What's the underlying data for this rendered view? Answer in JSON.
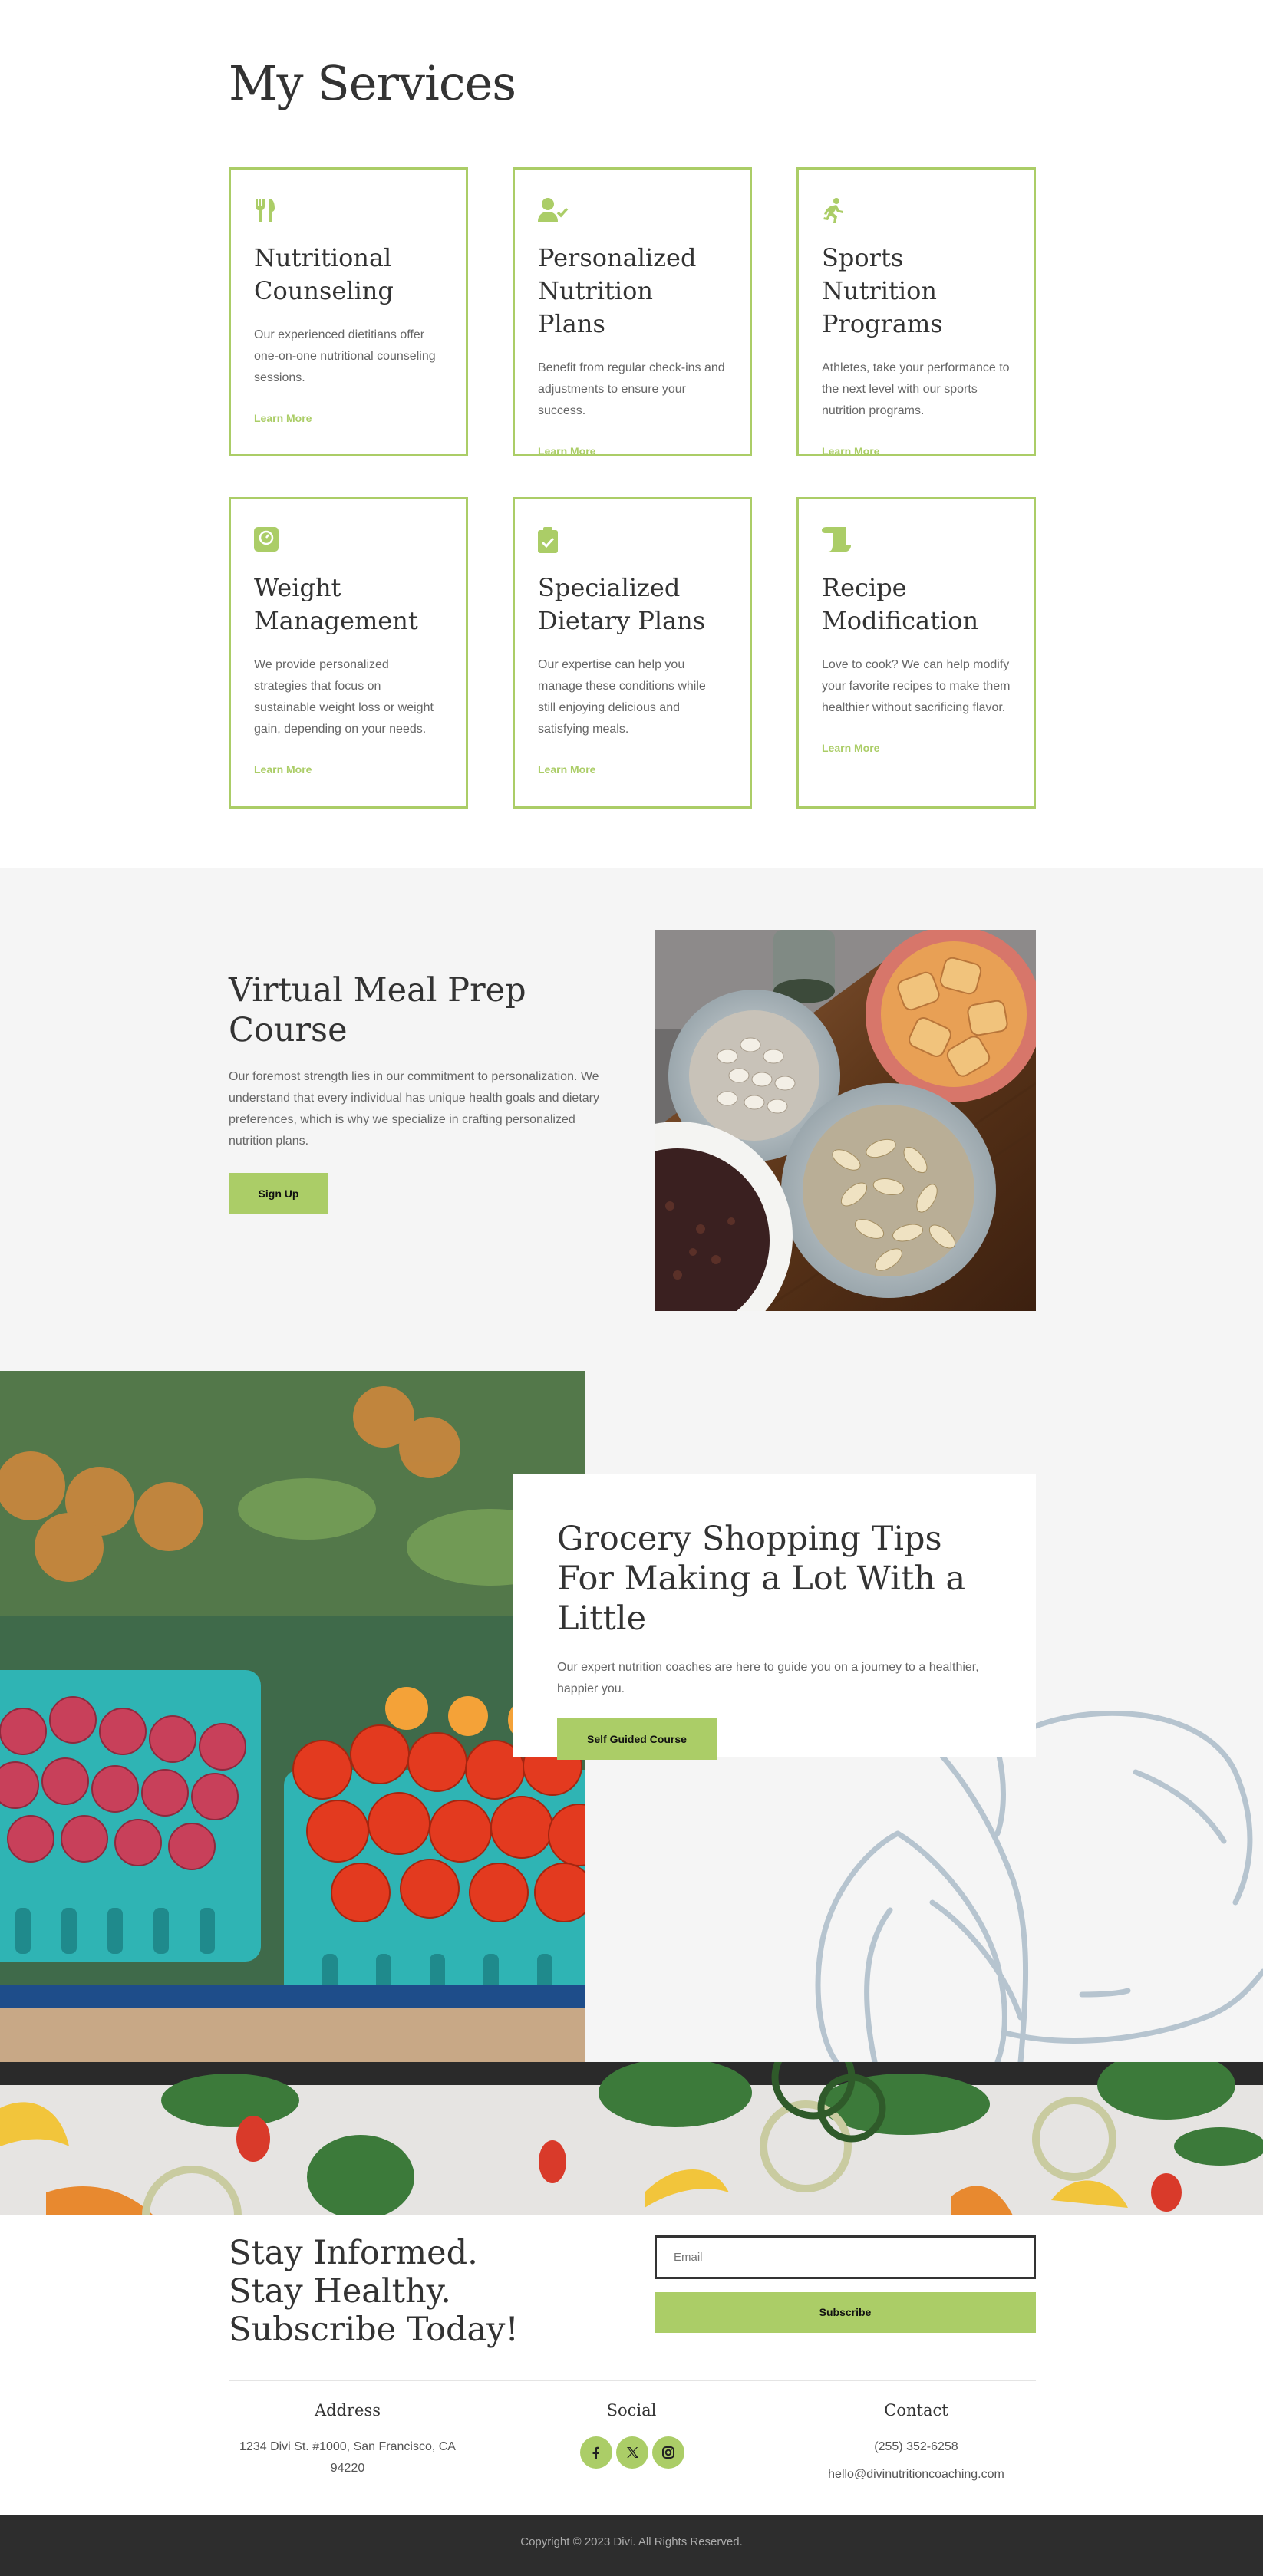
{
  "services": {
    "title": "My Services",
    "cards": [
      {
        "icon": "utensils-icon",
        "title": "Nutritional Counseling",
        "text": "Our experienced dietitians offer one-on-one nutritional counseling sessions.",
        "link": "Learn More"
      },
      {
        "icon": "user-check-icon",
        "title": "Personalized Nutrition Plans",
        "text": "Benefit from regular check-ins and adjustments to ensure your success.",
        "link": "Learn More"
      },
      {
        "icon": "running-person-icon",
        "title": "Sports Nutrition Programs",
        "text": "Athletes, take your performance to the next level with our sports nutrition programs.",
        "link": "Learn More"
      },
      {
        "icon": "weight-scale-icon",
        "title": "Weight Management",
        "text": "We provide personalized strategies that focus on sustainable weight loss or weight gain, depending on your needs.",
        "link": "Learn More"
      },
      {
        "icon": "clipboard-check-icon",
        "title": "Specialized Dietary Plans",
        "text": "Our expertise can help you manage these conditions while still enjoying delicious and satisfying meals.",
        "link": "Learn More"
      },
      {
        "icon": "scroll-icon",
        "title": "Recipe Modification",
        "text": "Love to cook? We can help modify your favorite recipes to make them healthier without sacrificing flavor.",
        "link": "Learn More"
      }
    ]
  },
  "virtual": {
    "title": "Virtual Meal Prep Course",
    "text": "Our foremost strength lies in our commitment to personalization. We understand that every individual has unique health goals and dietary preferences, which is why we specialize in crafting personalized nutrition plans.",
    "button": "Sign Up"
  },
  "grocery": {
    "title": "Grocery Shopping Tips For Making a Lot With a Little",
    "text": "Our expert nutrition coaches are here to guide you on a journey to a healthier, happier you.",
    "button": "Self Guided Course"
  },
  "newsletter": {
    "title": "Stay Informed. Stay Healthy. Subscribe Today!",
    "email_placeholder": "Email",
    "button": "Subscribe"
  },
  "footer": {
    "address_heading": "Address",
    "address_line1": "1234 Divi St. #1000, San Francisco, CA",
    "address_line2": "94220",
    "social_heading": "Social",
    "social_icons": [
      "facebook-icon",
      "x-twitter-icon",
      "instagram-icon"
    ],
    "contact_heading": "Contact",
    "phone": "(255) 352-6258",
    "email": "hello@divinutritioncoaching.com",
    "copyright": "Copyright © 2023 Divi. All Rights Reserved."
  },
  "colors": {
    "accent": "#abcd67",
    "text_dark": "#333333",
    "text_body": "#666666",
    "band_gray": "#f5f5f5",
    "footer_bar": "#2d2d2d",
    "line_art": "#b6c4cf"
  }
}
